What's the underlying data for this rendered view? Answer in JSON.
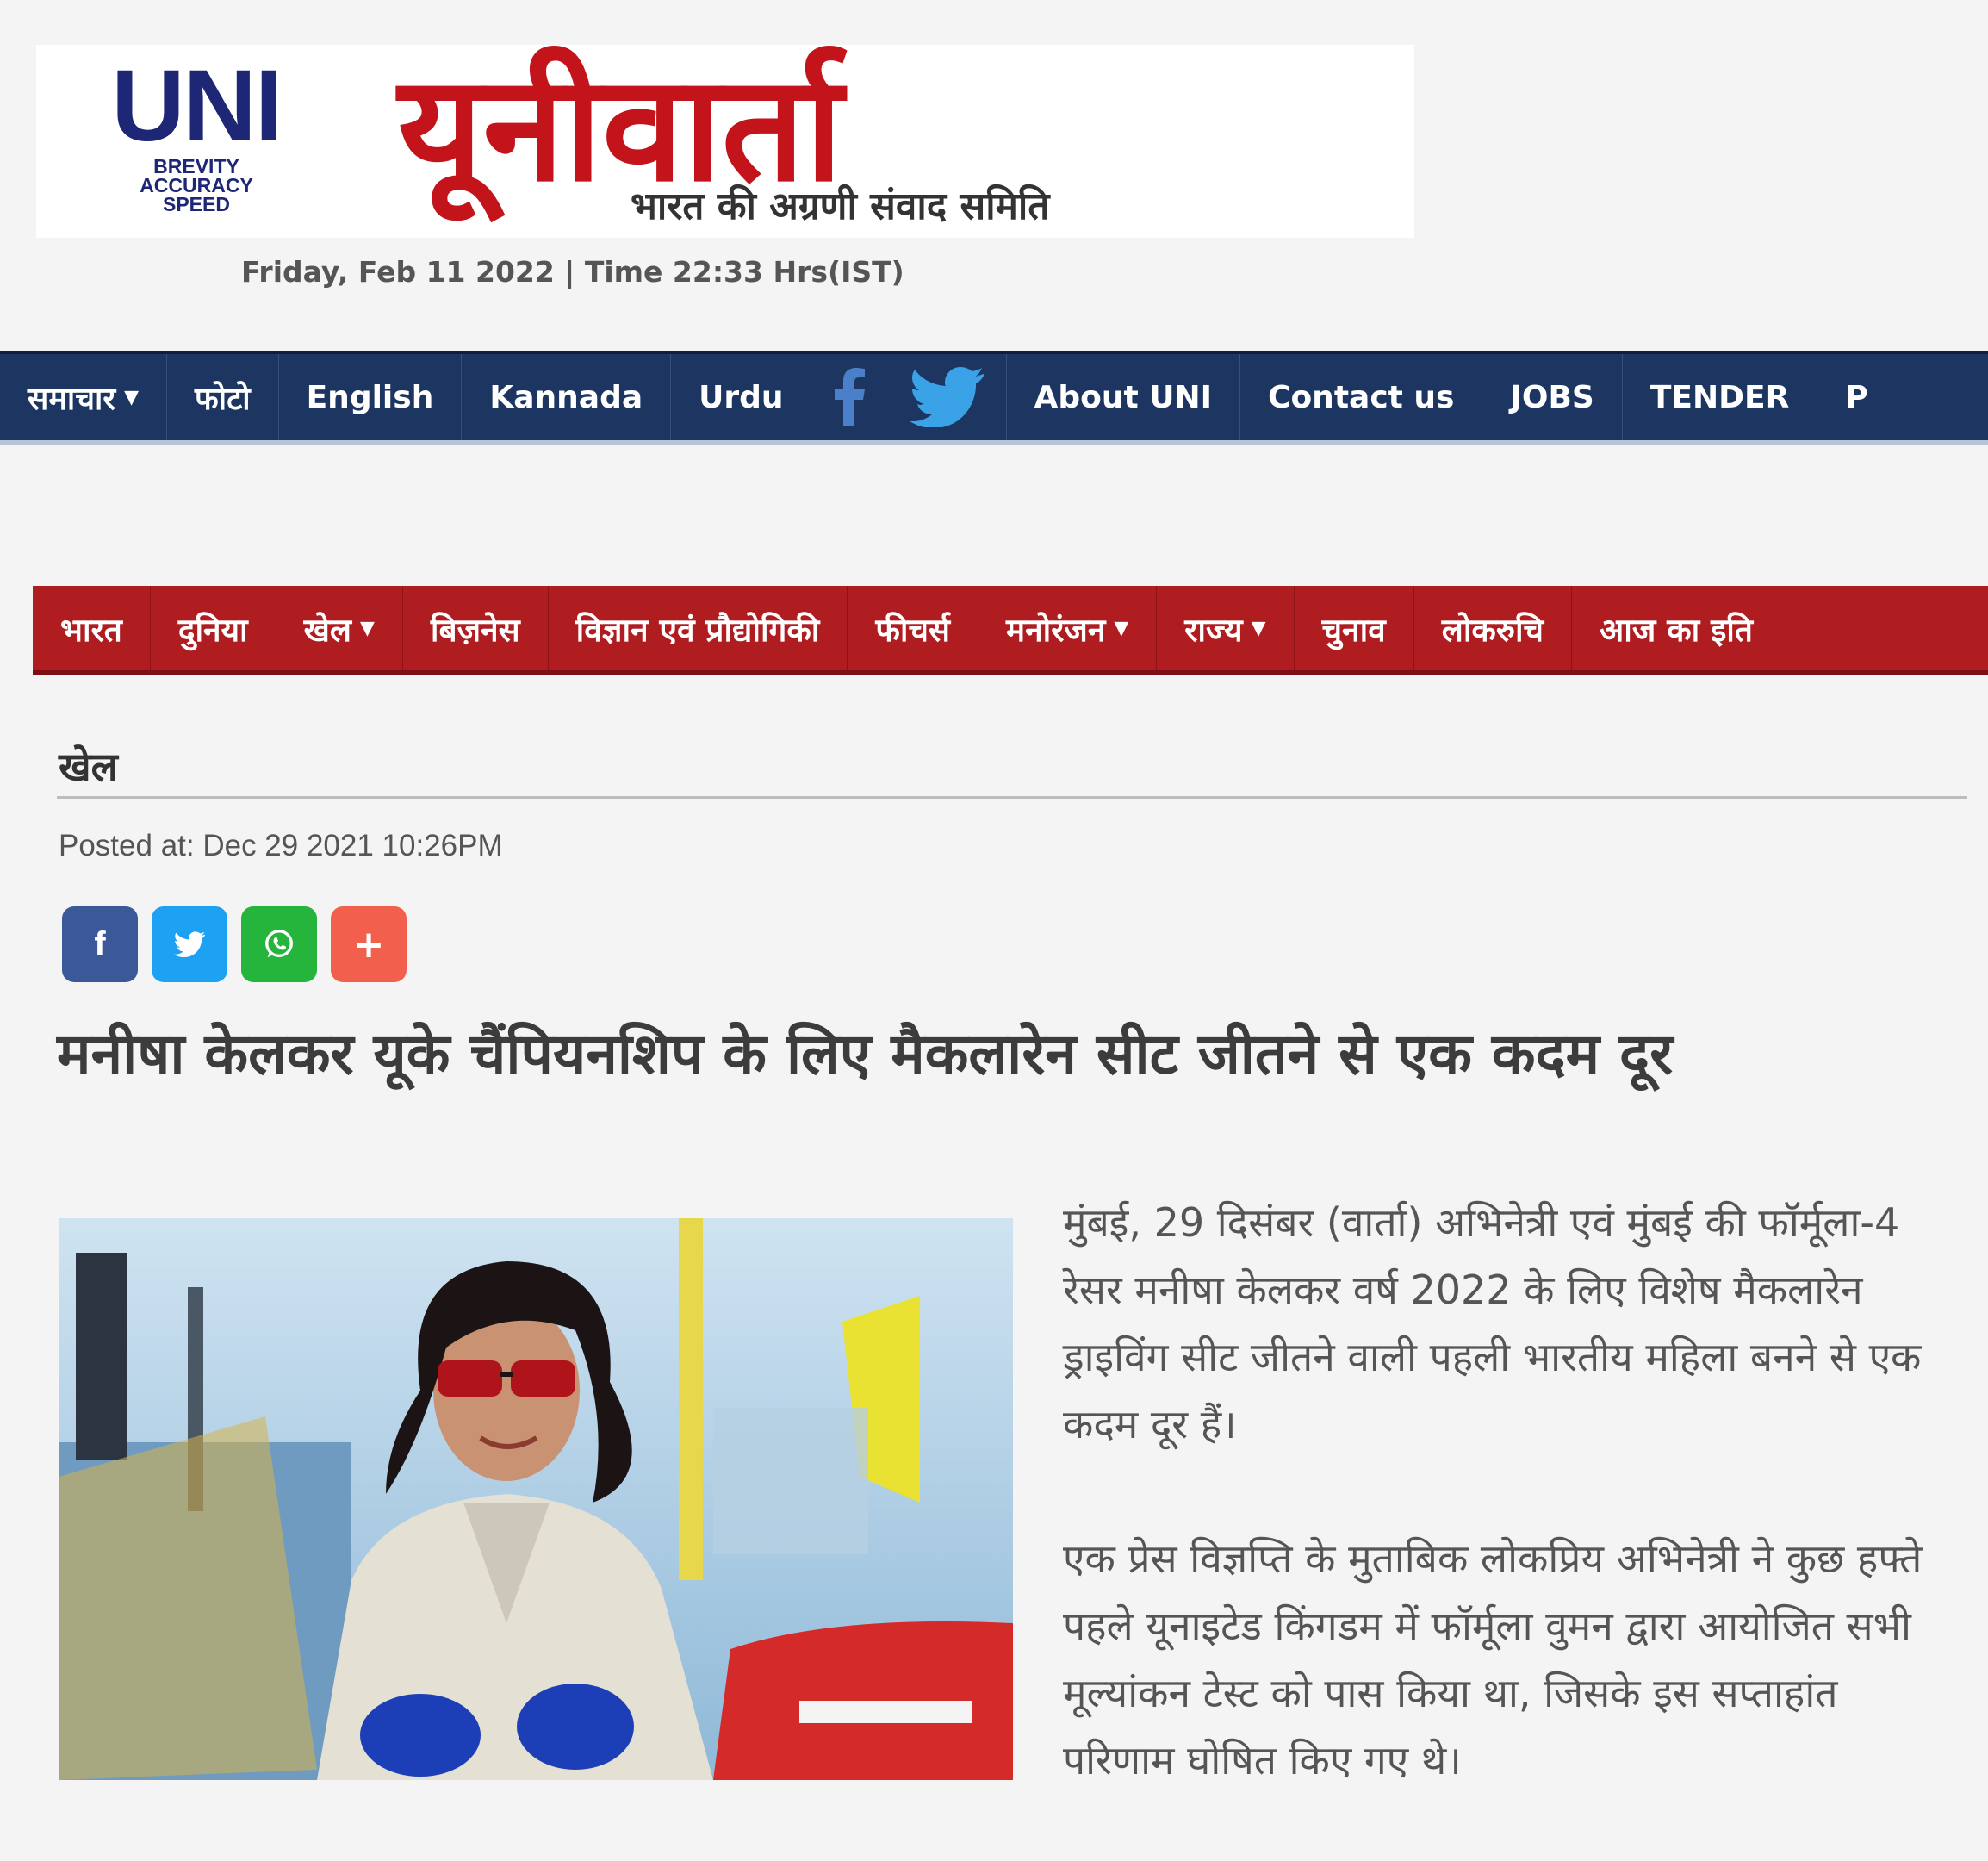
{
  "header": {
    "logo_mark": "UNI",
    "logo_tagline": [
      "BREVITY",
      "ACCURACY",
      "SPEED"
    ],
    "brand_name": "यूनीवार्ता",
    "brand_tagline": "भारत की अग्रणी संवाद समिति",
    "datetime": "Friday, Feb 11 2022 | Time 22:33 Hrs(IST)"
  },
  "topnav": {
    "items": [
      {
        "label": "समाचार",
        "has_dropdown": true
      },
      {
        "label": "फोटो"
      },
      {
        "label": "English"
      },
      {
        "label": "Kannada"
      },
      {
        "label": "Urdu"
      },
      {
        "icon": "facebook-icon"
      },
      {
        "icon": "twitter-icon"
      },
      {
        "label": "About UNI"
      },
      {
        "label": "Contact us"
      },
      {
        "label": "JOBS"
      },
      {
        "label": "TENDER"
      },
      {
        "label": "P"
      }
    ]
  },
  "catnav": {
    "items": [
      {
        "label": "भारत"
      },
      {
        "label": "दुनिया"
      },
      {
        "label": "खेल",
        "has_dropdown": true
      },
      {
        "label": "बिज़नेस"
      },
      {
        "label": "विज्ञान एवं प्रौद्योगिकी"
      },
      {
        "label": "फीचर्स"
      },
      {
        "label": "मनोरंजन",
        "has_dropdown": true
      },
      {
        "label": "राज्य",
        "has_dropdown": true
      },
      {
        "label": "चुनाव"
      },
      {
        "label": "लोकरुचि"
      },
      {
        "label": "आज का इति"
      }
    ]
  },
  "article": {
    "section": "खेल",
    "posted_at": "Posted at: Dec 29 2021 10:26PM",
    "share_buttons": [
      {
        "icon": "facebook-icon",
        "glyph": "f"
      },
      {
        "icon": "twitter-icon",
        "glyph": ""
      },
      {
        "icon": "whatsapp-icon",
        "glyph": ""
      },
      {
        "icon": "plus-icon",
        "glyph": "+"
      }
    ],
    "headline": "मनीषा केलकर यूके चैंपियनशिप के लिए मैकलारेन सीट जीतने से एक कदम दूर",
    "paragraphs": [
      "मुंबई, 29 दिसंबर (वार्ता) अभिनेत्री एवं मुंबई की फॉर्मूला-4 रेसर मनीषा केलकर वर्ष 2022 के लिए विशेष मैकलारेन ड्राइविंग सीट जीतने वाली पहली भारतीय महिला बनने से एक कदम दूर हैं।",
      "एक प्रेस विज्ञप्ति के मुताबिक लोकप्रिय अभिनेत्री ने कुछ हफ्ते पहले यूनाइटेड किंगडम में फॉर्मूला वुमन द्वारा आयोजित सभी मूल्यांकन टेस्ट को पास किया था, जिसके इस सप्ताहांत परिणाम घोषित किए गए थे।"
    ]
  },
  "colors": {
    "topnav_bg": "#1d3661",
    "catnav_bg": "#b01d21",
    "brand_red": "#c3141b",
    "uni_navy": "#1d2775"
  }
}
